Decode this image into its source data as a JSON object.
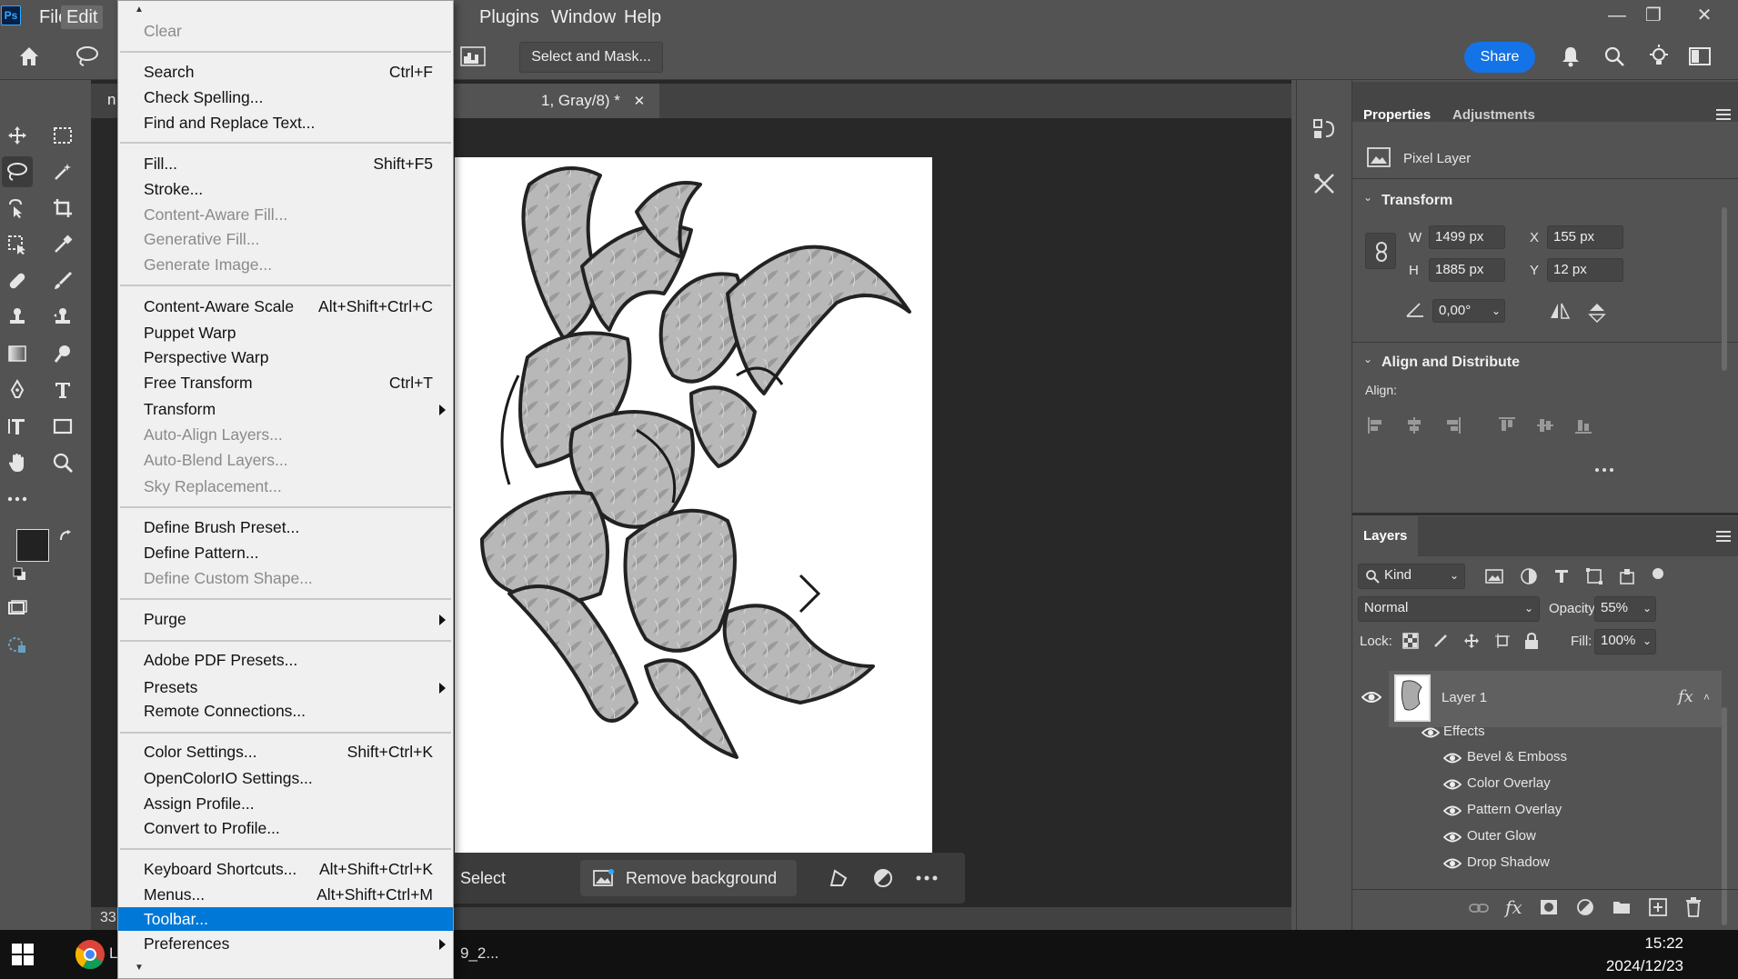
{
  "app": {
    "logo": "Ps",
    "menus": [
      "File",
      "Edit",
      "Plugins",
      "Window",
      "Help"
    ],
    "active_menu": "Edit"
  },
  "optionsbar": {
    "select_and_mask": "Select and Mask...",
    "share": "Share"
  },
  "document": {
    "tab_title": "1, Gray/8) *",
    "tab_prefix": "n",
    "zoom": "33"
  },
  "context_bar": {
    "select_subject": "Select subject",
    "remove_background": "Remove background"
  },
  "edit_menu": {
    "items": [
      {
        "label": "Clear",
        "shortcut": "",
        "disabled": true
      },
      {
        "label": "Search",
        "shortcut": "Ctrl+F"
      },
      {
        "label": "Check Spelling...",
        "shortcut": ""
      },
      {
        "label": "Find and Replace Text...",
        "shortcut": ""
      },
      {
        "label": "Fill...",
        "shortcut": "Shift+F5"
      },
      {
        "label": "Stroke...",
        "shortcut": ""
      },
      {
        "label": "Content-Aware Fill...",
        "shortcut": "",
        "disabled": true
      },
      {
        "label": "Generative Fill...",
        "shortcut": "",
        "disabled": true
      },
      {
        "label": "Generate Image...",
        "shortcut": "",
        "disabled": true
      },
      {
        "label": "Content-Aware Scale",
        "shortcut": "Alt+Shift+Ctrl+C"
      },
      {
        "label": "Puppet Warp",
        "shortcut": ""
      },
      {
        "label": "Perspective Warp",
        "shortcut": ""
      },
      {
        "label": "Free Transform",
        "shortcut": "Ctrl+T"
      },
      {
        "label": "Transform",
        "shortcut": "",
        "submenu": true
      },
      {
        "label": "Auto-Align Layers...",
        "shortcut": "",
        "disabled": true
      },
      {
        "label": "Auto-Blend Layers...",
        "shortcut": "",
        "disabled": true
      },
      {
        "label": "Sky Replacement...",
        "shortcut": "",
        "disabled": true
      },
      {
        "label": "Define Brush Preset...",
        "shortcut": ""
      },
      {
        "label": "Define Pattern...",
        "shortcut": ""
      },
      {
        "label": "Define Custom Shape...",
        "shortcut": "",
        "disabled": true
      },
      {
        "label": "Purge",
        "shortcut": "",
        "submenu": true
      },
      {
        "label": "Adobe PDF Presets...",
        "shortcut": ""
      },
      {
        "label": "Presets",
        "shortcut": "",
        "submenu": true
      },
      {
        "label": "Remote Connections...",
        "shortcut": ""
      },
      {
        "label": "Color Settings...",
        "shortcut": "Shift+Ctrl+K"
      },
      {
        "label": "OpenColorIO Settings...",
        "shortcut": ""
      },
      {
        "label": "Assign Profile...",
        "shortcut": ""
      },
      {
        "label": "Convert to Profile...",
        "shortcut": ""
      },
      {
        "label": "Keyboard Shortcuts...",
        "shortcut": "Alt+Shift+Ctrl+K"
      },
      {
        "label": "Menus...",
        "shortcut": "Alt+Shift+Ctrl+M"
      },
      {
        "label": "Toolbar...",
        "shortcut": "",
        "highlighted": true
      },
      {
        "label": "Preferences",
        "shortcut": "",
        "submenu": true
      }
    ]
  },
  "properties": {
    "tabs": [
      "Properties",
      "Adjustments"
    ],
    "layer_type": "Pixel Layer",
    "transform_title": "Transform",
    "w_label": "W",
    "w_value": "1499 px",
    "h_label": "H",
    "h_value": "1885 px",
    "x_label": "X",
    "x_value": "155 px",
    "y_label": "Y",
    "y_value": "12 px",
    "angle_value": "0,00°",
    "align_title": "Align and Distribute",
    "align_label": "Align:"
  },
  "layers": {
    "title": "Layers",
    "filter_kind": "Kind",
    "blend_mode": "Normal",
    "opacity_label": "Opacity:",
    "opacity_value": "55%",
    "lock_label": "Lock:",
    "fill_label": "Fill:",
    "fill_value": "100%",
    "layer_name": "Layer 1",
    "fx_badge": "fx",
    "effects_label": "Effects",
    "effects": [
      "Bevel & Emboss",
      "Color Overlay",
      "Pattern Overlay",
      "Outer Glow",
      "Drop Shadow"
    ]
  },
  "taskbar": {
    "time": "15:22",
    "date": "2024/12/23",
    "chrome_label": "L",
    "file_label": "9_2..."
  },
  "colors": {
    "accent": "#1473e6",
    "menu_highlight": "#0078d7",
    "panel_bg": "#535353",
    "canvas_bg": "#282828"
  }
}
